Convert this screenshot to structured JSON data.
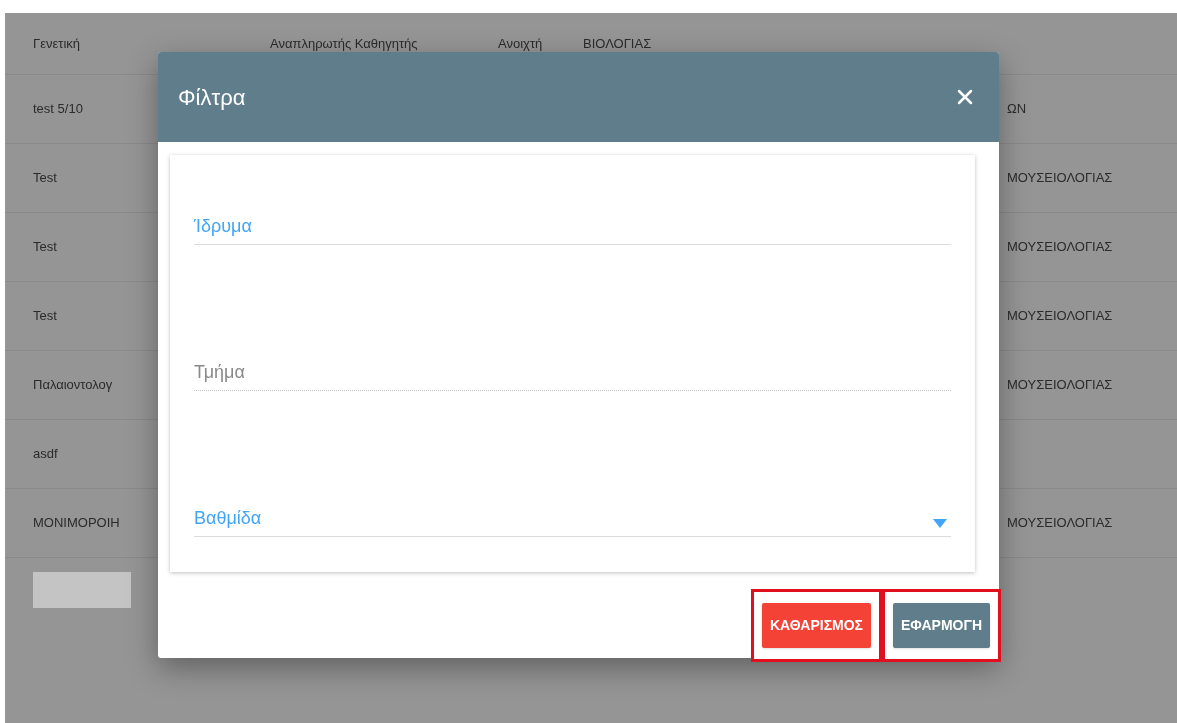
{
  "background_table": {
    "rows": [
      {
        "column_1": "Γενετική",
        "column_2": "Αναπληρωτής Καθηγητής",
        "column_3": "Ανοιχτή",
        "column_4": "ΒΙΟΛΟΓΙΑΣ"
      },
      {
        "column_1": "test 5/10",
        "column_5": "ΩΝ"
      },
      {
        "column_1": "Test",
        "column_5": "ΜΟΥΣΕΙΟΛΟΓΙΑΣ"
      },
      {
        "column_1": "Test",
        "column_5": "ΜΟΥΣΕΙΟΛΟΓΙΑΣ"
      },
      {
        "column_1": "Test",
        "column_5": "ΜΟΥΣΕΙΟΛΟΓΙΑΣ"
      },
      {
        "column_1": "Παλαιοντολογ",
        "column_5": "ΜΟΥΣΕΙΟΛΟΓΙΑΣ"
      },
      {
        "column_1": "asdf"
      },
      {
        "column_1": "ΜΟΝΙΜΟΡΟΙΗ",
        "column_5": "ΜΟΥΣΕΙΟΛΟΓΙΑΣ"
      }
    ]
  },
  "dialog": {
    "title": "Φίλτρα",
    "fields": [
      {
        "kind": "text",
        "label": "Ίδρυμα",
        "active": true,
        "disabled": false
      },
      {
        "kind": "text",
        "label": "Τμήμα",
        "active": false,
        "disabled": true
      },
      {
        "kind": "select",
        "label": "Βαθμίδα",
        "active": true,
        "disabled": false
      }
    ],
    "buttons": [
      {
        "kind": "clear",
        "label": "ΚΑΘΑΡΙΣΜΟΣ",
        "highlighted": true
      },
      {
        "kind": "apply",
        "label": "ΕΦΑΡΜΟΓΗ",
        "highlighted": true
      }
    ]
  }
}
